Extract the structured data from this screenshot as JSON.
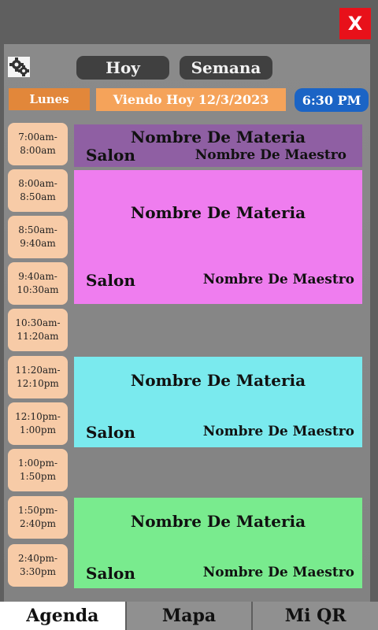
{
  "header": {
    "close_label": "X"
  },
  "toolbar": {
    "today_label": "Hoy",
    "week_label": "Semana",
    "day_label": "Lunes",
    "viewing_label": "Viendo Hoy 12/3/2023",
    "current_time": "6:30 PM"
  },
  "time_slots": [
    {
      "start": "7:00am-",
      "end": "8:00am"
    },
    {
      "start": "8:00am-",
      "end": "8:50am"
    },
    {
      "start": "8:50am-",
      "end": "9:40am"
    },
    {
      "start": "9:40am-",
      "end": "10:30am"
    },
    {
      "start": "10:30am-",
      "end": "11:20am"
    },
    {
      "start": "11:20am-",
      "end": "12:10pm"
    },
    {
      "start": "12:10pm-",
      "end": "1:00pm"
    },
    {
      "start": "1:00pm-",
      "end": "1:50pm"
    },
    {
      "start": "1:50pm-",
      "end": "2:40pm"
    },
    {
      "start": "2:40pm-",
      "end": "3:30pm"
    }
  ],
  "classes": [
    {
      "subject": "Nombre De Materia",
      "room": "Salon",
      "teacher": "Nombre De Maestro",
      "color": "#8f5fa3"
    },
    {
      "subject": "Nombre De Materia",
      "room": "Salon",
      "teacher": "Nombre De Maestro",
      "color": "#ef7def"
    },
    {
      "subject": "Nombre De Materia",
      "room": "Salon",
      "teacher": "Nombre De Maestro",
      "color": "#7aeaee"
    },
    {
      "subject": "Nombre De Materia",
      "room": "Salon",
      "teacher": "Nombre De Maestro",
      "color": "#79eb8e"
    }
  ],
  "tabs": [
    {
      "label": "Agenda",
      "active": true
    },
    {
      "label": "Mapa",
      "active": false
    },
    {
      "label": "Mi QR",
      "active": false
    }
  ],
  "icons": {
    "settings": "settings-gear-icon",
    "close": "close-icon"
  }
}
